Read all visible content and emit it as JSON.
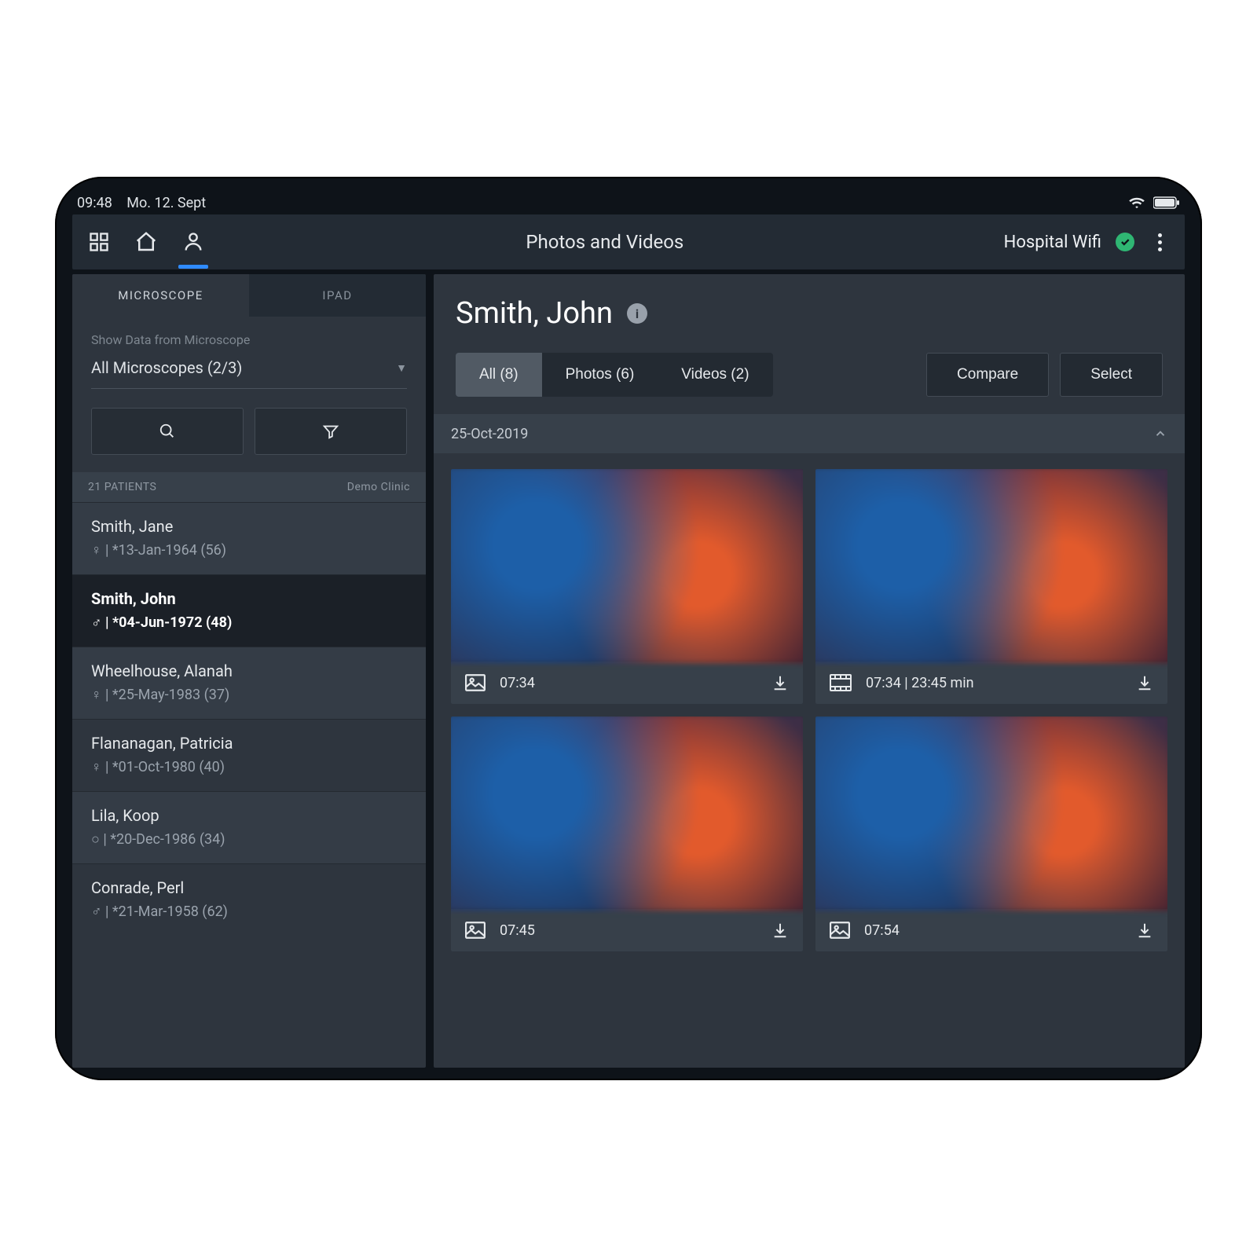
{
  "statusbar": {
    "time": "09:48",
    "date": "Mo. 12. Sept"
  },
  "topnav": {
    "title": "Photos and Videos",
    "wifi_name": "Hospital Wifi"
  },
  "sidebar": {
    "tabs": {
      "microscope": "MICROSCOPE",
      "ipad": "IPAD"
    },
    "sub_label": "Show Data from Microscope",
    "select_value": "All Microscopes (2/3)",
    "list_header_left": "21 PATIENTS",
    "list_header_right": "Demo Clinic",
    "patients": [
      {
        "name": "Smith, Jane",
        "meta": "♀ | *13-Jan-1964 (56)",
        "selected": false
      },
      {
        "name": "Smith, John",
        "meta": "♂ | *04-Jun-1972 (48)",
        "selected": true
      },
      {
        "name": "Wheelhouse, Alanah",
        "meta": "♀ | *25-May-1983 (37)",
        "selected": false
      },
      {
        "name": "Flananagan, Patricia",
        "meta": "♀ | *01-Oct-1980 (40)",
        "selected": false
      },
      {
        "name": "Lila, Koop",
        "meta": "○ | *20-Dec-1986 (34)",
        "selected": false
      },
      {
        "name": "Conrade, Perl",
        "meta": "♂ | *21-Mar-1958 (62)",
        "selected": false
      }
    ]
  },
  "main": {
    "patient_title": "Smith, John",
    "seg": {
      "all": "All (8)",
      "photos": "Photos (6)",
      "videos": "Videos (2)"
    },
    "compare": "Compare",
    "select": "Select",
    "date_header": "25-Oct-2019",
    "items": [
      {
        "kind": "photo",
        "time": "07:34"
      },
      {
        "kind": "video",
        "time": "07:34",
        "duration": "23:45 min"
      },
      {
        "kind": "photo",
        "time": "07:45"
      },
      {
        "kind": "photo",
        "time": "07:54"
      }
    ]
  }
}
